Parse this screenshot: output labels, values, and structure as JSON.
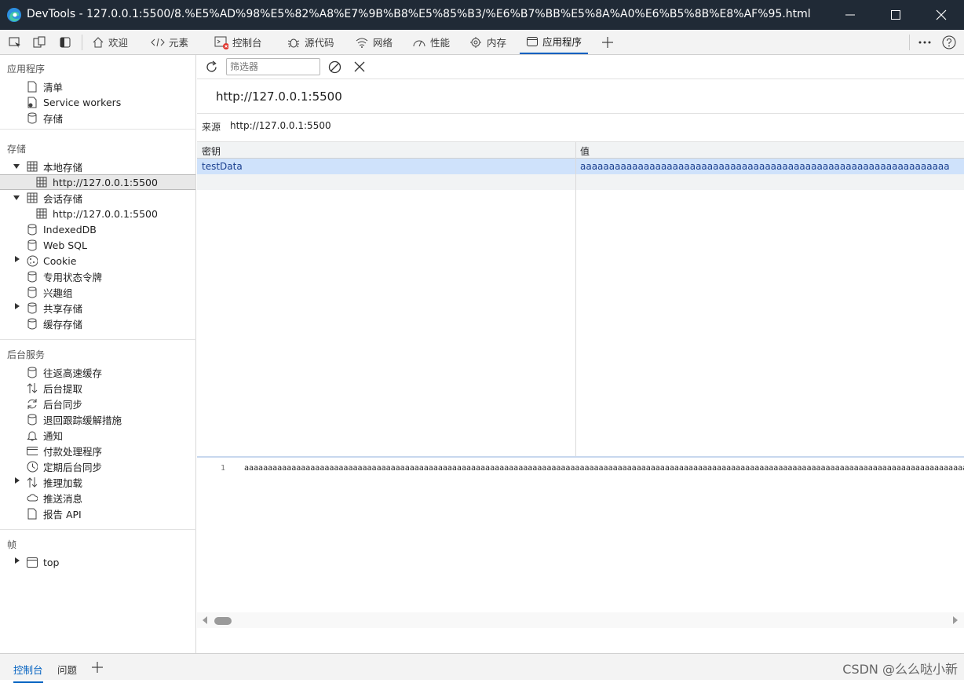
{
  "window": {
    "title": "DevTools - 127.0.0.1:5500/8.%E5%AD%98%E5%82%A8%E7%9B%B8%E5%85%B3/%E6%B7%BB%E5%8A%A0%E6%B5%8B%E8%AF%95.html"
  },
  "tabs": [
    {
      "label": "欢迎"
    },
    {
      "label": "元素"
    },
    {
      "label": "控制台"
    },
    {
      "label": "源代码"
    },
    {
      "label": "网络"
    },
    {
      "label": "性能"
    },
    {
      "label": "内存"
    },
    {
      "label": "应用程序"
    }
  ],
  "sidebar": {
    "app_title": "应用程序",
    "app_items": [
      "清单",
      "Service workers",
      "存储"
    ],
    "storage_title": "存储",
    "local_storage": "本地存储",
    "local_origin": "http://127.0.0.1:5500",
    "session_storage": "会话存储",
    "session_origin": "http://127.0.0.1:5500",
    "storage_items": [
      "IndexedDB",
      "Web SQL",
      "Cookie",
      "专用状态令牌",
      "兴趣组",
      "共享存储",
      "缓存存储"
    ],
    "bg_title": "后台服务",
    "bg_items": [
      "往返高速缓存",
      "后台提取",
      "后台同步",
      "退回跟踪缓解措施",
      "通知",
      "付款处理程序",
      "定期后台同步",
      "推理加载",
      "推送消息",
      "报告 API"
    ],
    "frames_title": "帧",
    "frame_top": "top"
  },
  "toolbar": {
    "filter_placeholder": "筛选器"
  },
  "storage_view": {
    "origin_heading": "http://127.0.0.1:5500",
    "origin_label": "来源",
    "origin_value": "http://127.0.0.1:5500",
    "columns": [
      "密钥",
      "值"
    ],
    "rows": [
      {
        "key": "testData",
        "value": "aaaaaaaaaaaaaaaaaaaaaaaaaaaaaaaaaaaaaaaaaaaaaaaaaaaaaaaaaaaaaaaaaaaaaaaaaa…"
      }
    ],
    "preview_line_number": "1",
    "preview_value": "aaaaaaaaaaaaaaaaaaaaaaaaaaaaaaaaaaaaaaaaaaaaaaaaaaaaaaaaaaaaaaaaaaaaaaaaaaaaaaaaaaaaaaaaaaaaaaaaaaaaaaaaaaaaaaaaaaaaaaaaaaaaaaaaaaaaaaaaaaaaaaaaaaaaaaaaaaaaaaaaaaaaaa"
  },
  "drawer": {
    "tabs": [
      "控制台",
      "问题"
    ]
  },
  "watermark": "CSDN @么么哒小新"
}
